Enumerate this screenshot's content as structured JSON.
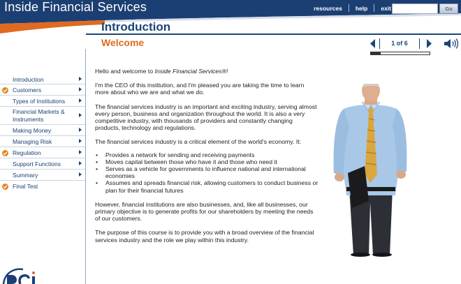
{
  "app": {
    "title": "Inside Financial Services"
  },
  "toplinks": {
    "resources": "resources",
    "help": "help",
    "exit": "exit"
  },
  "search": {
    "value": "",
    "placeholder": "",
    "go_label": "Go"
  },
  "section_title": "Introduction",
  "page_title": "Welcome",
  "pager": {
    "indicator": "1 of 6",
    "progress_fraction": 0.1667
  },
  "colors": {
    "brand_blue": "#1c4577",
    "accent_orange": "#e06a21"
  },
  "icons": {
    "prev": "prev-arrow-icon",
    "next": "next-arrow-icon",
    "audio": "speaker-icon",
    "complete": "check-icon",
    "submenu": "chevron-right-icon"
  },
  "nav": {
    "items": [
      {
        "label": "Introduction"
      },
      {
        "label": "Customers"
      },
      {
        "label": "Types of Institutions"
      },
      {
        "label": "Financial Markets &",
        "label2": "Instruments"
      },
      {
        "label": "Making Money"
      },
      {
        "label": "Managing Risk"
      },
      {
        "label": "Regulation"
      },
      {
        "label": "Support Functions"
      },
      {
        "label": "Summary"
      },
      {
        "label": "Final Test"
      }
    ]
  },
  "content": {
    "greeting_prefix": "Hello and welcome to ",
    "greeting_em": "Inside Financial Services®",
    "greeting_suffix": "!",
    "p1": "I'm the CEO of this institution, and I'm pleased you are taking the time to learn more about who we are and what we do.",
    "p2": "The financial services industry is an important and exciting industry, serving almost every person, business and organization throughout the world. It is also a very competitive industry, with thousands of providers and constantly changing products, technology and regulations.",
    "p3": "The financial services industry is a critical element of the world's economy. It:",
    "bullets": [
      "Provides a network for sending and receiving payments",
      "Moves capital between those who have it and those who need it",
      "Serves as a vehicle for governments to influence national and international economies",
      "Assumes and spreads financial risk, allowing customers to conduct business or plan for their financial futures"
    ],
    "p4": "However, financial institutions are also businesses, and, like all businesses, our primary objective is to generate profits for our shareholders by meeting the needs of our customers.",
    "p5": "The purpose of this course is to provide you with a broad overview of the financial services industry and the role we play within this industry."
  }
}
